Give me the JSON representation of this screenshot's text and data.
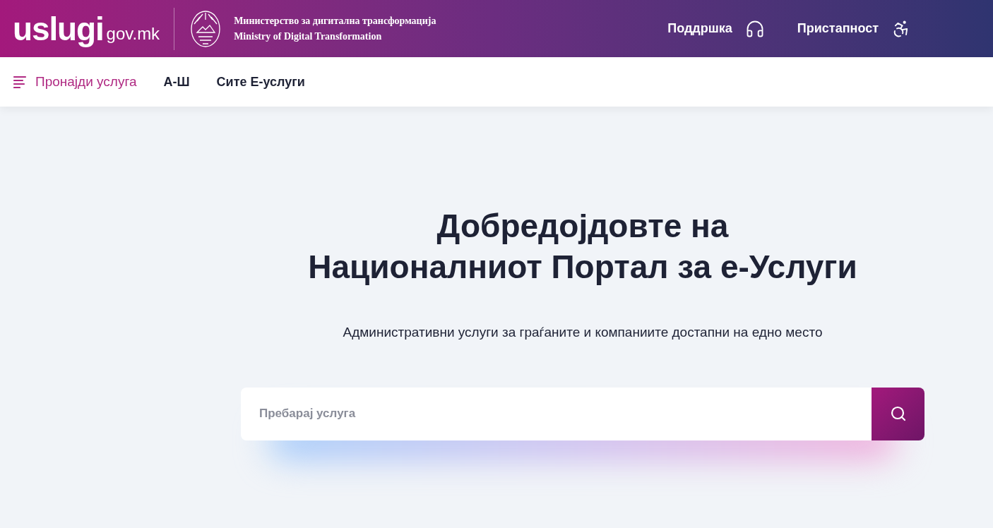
{
  "header": {
    "logo": {
      "word": "uslugi",
      "domain": "gov.mk"
    },
    "ministry": {
      "name_mk": "Министерство за дигитална трансформација",
      "name_en": "Ministry of Digital Transformation"
    },
    "links": [
      {
        "label": "Поддршка",
        "kind": "support"
      },
      {
        "label": "Пристапност",
        "kind": "accessibility"
      }
    ]
  },
  "nav": {
    "items": [
      {
        "label": "Пронајди услуга",
        "kind": "menu"
      },
      {
        "label": "А-Ш",
        "kind": "link"
      },
      {
        "label": "Сите Е-услуги",
        "kind": "link"
      }
    ]
  },
  "hero": {
    "title_lines": [
      "Добредојдовте на",
      "Националниот Портал за е-Услуги"
    ],
    "subtitle": "Административни услуги за граѓаните и компаниите достапни на едно место",
    "search": {
      "placeholder": "Пребарај услуга"
    }
  }
}
